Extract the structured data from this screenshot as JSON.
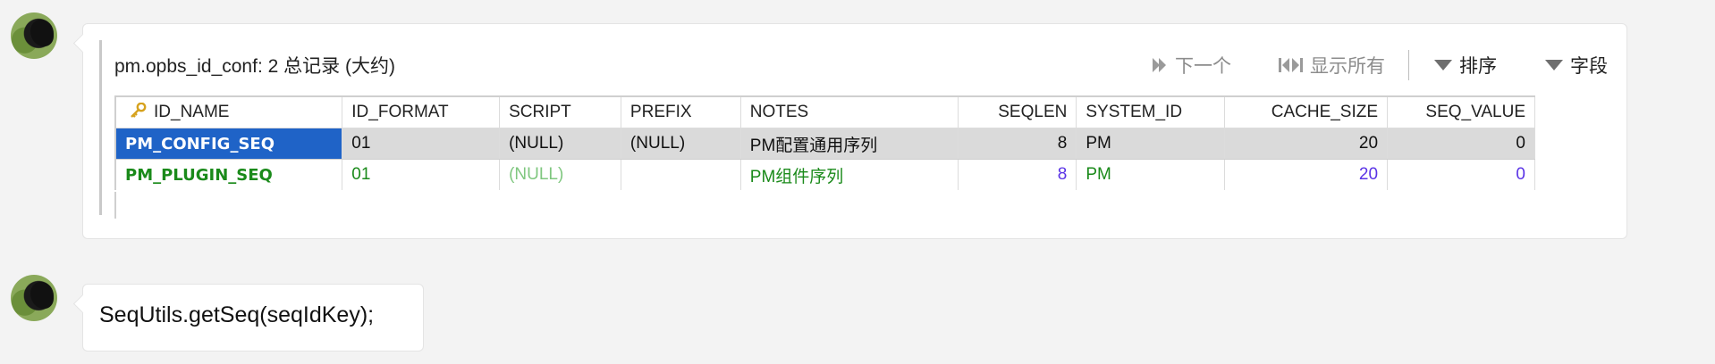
{
  "messages": [
    {
      "result_title": "pm.opbs_id_conf: 2 总记录 (大约)",
      "toolbar": {
        "next_label": "下一个",
        "show_all_label": "显示所有",
        "sort_label": "排序",
        "fields_label": "字段"
      },
      "columns": [
        "ID_NAME",
        "ID_FORMAT",
        "SCRIPT",
        "PREFIX",
        "NOTES",
        "SEQLEN",
        "SYSTEM_ID",
        "CACHE_SIZE",
        "SEQ_VALUE"
      ],
      "rows": [
        {
          "id_name": "PM_CONFIG_SEQ",
          "id_format": "01",
          "script": "(NULL)",
          "prefix": "(NULL)",
          "notes": "PM配置通用序列",
          "seqlen": "8",
          "system_id": "PM",
          "cache_size": "20",
          "seq_value": "0"
        },
        {
          "id_name": "PM_PLUGIN_SEQ",
          "id_format": "01",
          "script": "(NULL)",
          "prefix": "",
          "notes": "PM组件序列",
          "seqlen": "8",
          "system_id": "PM",
          "cache_size": "20",
          "seq_value": "0"
        }
      ]
    },
    {
      "code": "SeqUtils.getSeq(seqIdKey);"
    }
  ],
  "colors": {
    "selected_cell": "#1f63c7",
    "row_text_green": "#1a8a1a",
    "null_green": "#7fc77f",
    "number_purple": "#5a33e6"
  }
}
